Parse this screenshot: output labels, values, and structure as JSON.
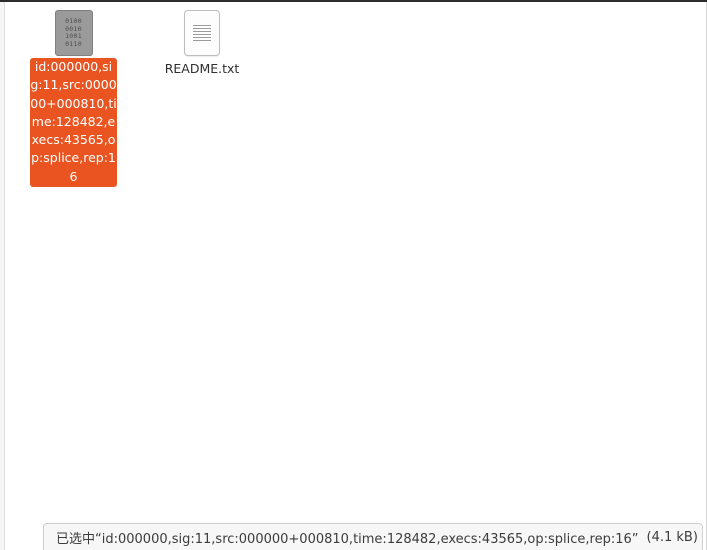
{
  "files": [
    {
      "name": "id:000000,sig:11,src:000000+000810,time:128482,execs:43565,op:splice,rep:16",
      "icon": "binary-file-icon",
      "icon_glyph": "0100\n0010\n1001\n0110",
      "selected": true
    },
    {
      "name": "README.txt",
      "icon": "text-file-icon",
      "selected": false
    }
  ],
  "status_bar": {
    "selection_text": "已选中“id:000000,sig:11,src:000000+000810,time:128482,execs:43565,op:splice,rep:16”",
    "size_text": "(4.1 kB)"
  },
  "colors": {
    "selection_accent": "#e95420",
    "binary_icon": "#9a9a9a",
    "background": "#ffffff"
  }
}
